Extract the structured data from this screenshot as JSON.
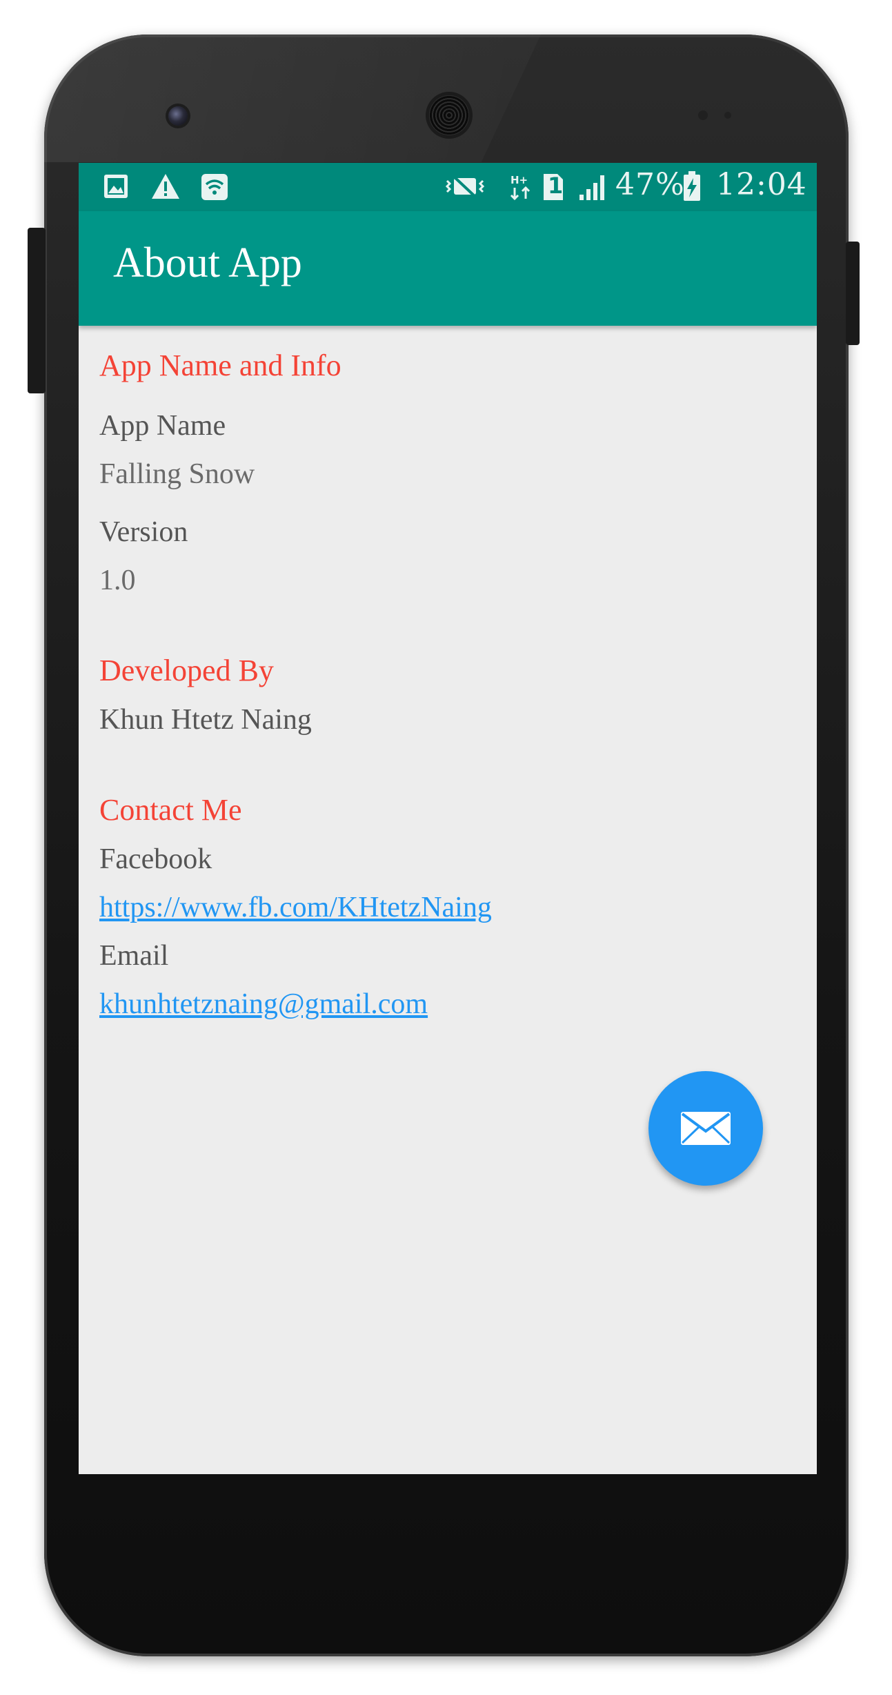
{
  "status_bar": {
    "battery": "47%",
    "time": "12:04",
    "sim_slot": "1",
    "icons": [
      "image-icon",
      "warning-icon",
      "wifi-icon",
      "vibrate-mute-icon",
      "data-hplus-icon",
      "sim-icon",
      "signal-icon",
      "battery-charging-icon"
    ]
  },
  "app_bar": {
    "title": "About App"
  },
  "sections": {
    "app_info": {
      "title": "App Name and Info",
      "app_name_label": "App Name",
      "app_name_value": "Falling Snow",
      "version_label": "Version",
      "version_value": "1.0"
    },
    "developer": {
      "title": "Developed By",
      "name": "Khun Htetz Naing"
    },
    "contact": {
      "title": "Contact Me",
      "facebook_label": "Facebook",
      "facebook_link": "https://www.fb.com/KHtetzNaing",
      "email_label": "Email",
      "email_link": "khunhtetznaing@gmail.com"
    }
  },
  "fab": {
    "icon": "mail-icon"
  },
  "colors": {
    "status_bar": "#00897b",
    "app_bar": "#009688",
    "section_title": "#f44336",
    "link": "#2196f3",
    "fab": "#2196f3",
    "background": "#ededed"
  }
}
